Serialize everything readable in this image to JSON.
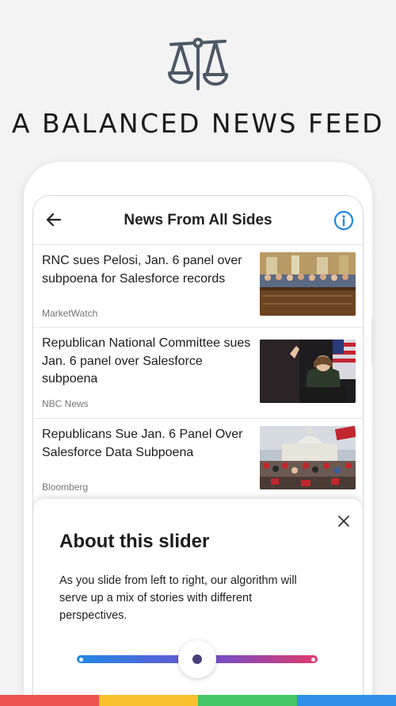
{
  "promo": {
    "icon": "balance-scale-icon",
    "title": "A BALANCED NEWS FEED"
  },
  "header": {
    "back_icon": "arrow-left-icon",
    "title": "News From All Sides",
    "info_icon": "info-circle-icon"
  },
  "articles": [
    {
      "headline": "RNC sues Pelosi, Jan. 6 panel over subpoena for Salesforce records",
      "source": "MarketWatch",
      "image": "congressional-hearing-photo"
    },
    {
      "headline": "Republican National Committee sues Jan. 6 panel over Salesforce subpoena",
      "source": "NBC News",
      "image": "speaker-at-podium-photo"
    },
    {
      "headline": "Republicans Sue Jan. 6 Panel Over Salesforce Data Subpoena",
      "source": "Bloomberg",
      "image": "capitol-crowd-photo"
    }
  ],
  "sheet": {
    "close_icon": "close-icon",
    "title": "About this slider",
    "description": "As you slide from left to right, our algorithm will serve up a mix of stories with different perspectives."
  },
  "slider": {
    "value": 0.5,
    "colors": [
      "#1f88e5",
      "#5b5fd8",
      "#7a4bc4",
      "#e23a6b"
    ]
  },
  "bottom_stripe_colors": [
    "#f0524f",
    "#fbc02d",
    "#43c465",
    "#2f8fe8"
  ]
}
